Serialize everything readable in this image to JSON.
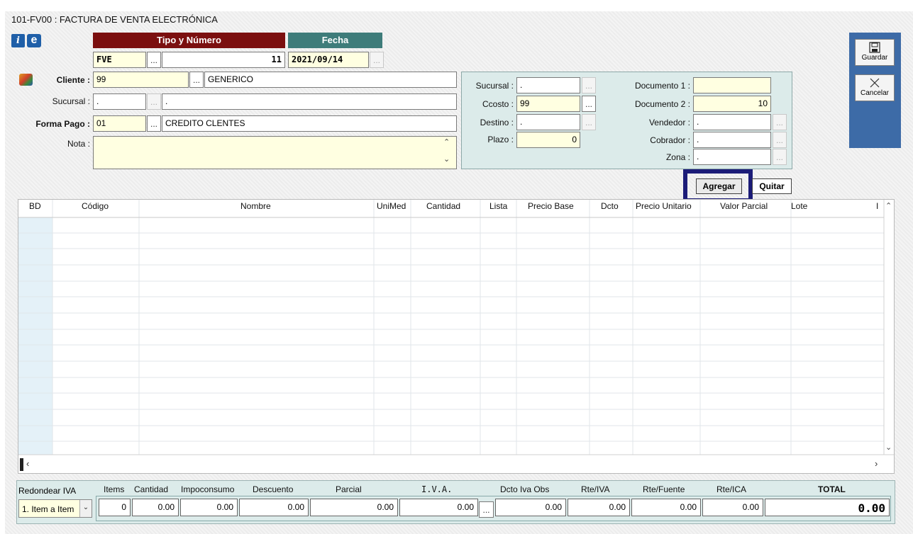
{
  "window": {
    "title": "101-FV00 : FACTURA DE VENTA ELECTRÓNICA"
  },
  "icons": {
    "info": "i",
    "e": "e"
  },
  "header": {
    "tipo_numero_label": "Tipo y Número",
    "fecha_label": "Fecha",
    "tipo": "FVE",
    "numero": "11",
    "fecha": "2021/09/14",
    "dots": "..."
  },
  "left_form": {
    "cliente_label": "Cliente :",
    "cliente_code": "99",
    "cliente_name": "GENERICO",
    "sucursal_label": "Sucursal :",
    "sucursal_code": ".",
    "sucursal_name": ".",
    "forma_pago_label": "Forma Pago :",
    "forma_pago_code": "01",
    "forma_pago_name": "CREDITO CLENTES",
    "nota_label": "Nota :",
    "nota_value": ""
  },
  "right_panel": {
    "sucursal_label": "Sucursal :",
    "sucursal_value": ".",
    "ccosto_label": "Ccosto :",
    "ccosto_value": "99",
    "destino_label": "Destino :",
    "destino_value": ".",
    "plazo_label": "Plazo :",
    "plazo_value": "0",
    "doc1_label": "Documento 1 :",
    "doc1_value": "",
    "doc2_label": "Documento 2 :",
    "doc2_value": "10",
    "vendedor_label": "Vendedor :",
    "vendedor_value": ".",
    "cobrador_label": "Cobrador :",
    "cobrador_value": ".",
    "zona_label": "Zona :",
    "zona_value": "."
  },
  "actions": {
    "agregar": "Agregar",
    "quitar": "Quitar"
  },
  "sidebar": {
    "guardar": "Guardar",
    "cancelar": "Cancelar"
  },
  "grid": {
    "columns": [
      "BD",
      "Código",
      "Nombre",
      "UniMed",
      "Cantidad",
      "Lista",
      "Precio Base",
      "Dcto",
      "Precio Unitario",
      "Valor Parcial",
      "Lote",
      "I"
    ]
  },
  "footer": {
    "redondear_label": "Redondear IVA",
    "redondear_value": "1. Item a Item",
    "headers": [
      "Items",
      "Cantidad",
      "Impoconsumo",
      "Descuento",
      "Parcial",
      "I.V.A.",
      "Dcto Iva Obs",
      "Rte/IVA",
      "Rte/Fuente",
      "Rte/ICA",
      "TOTAL"
    ],
    "values": [
      "0",
      "0.00",
      "0.00",
      "0.00",
      "0.00",
      "0.00",
      "0.00",
      "0.00",
      "0.00",
      "0.00",
      "0.00"
    ]
  },
  "colors": {
    "tipo_header": "#7b0f0f",
    "fecha_header": "#3e7c7a",
    "sidebar": "#3d6ba7",
    "highlight": "#1c1c78",
    "field_yellow": "#ffffe1",
    "panel": "#dcebea"
  }
}
